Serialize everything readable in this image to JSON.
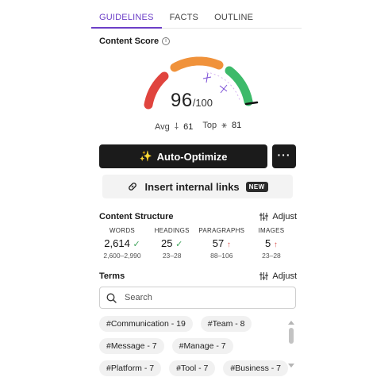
{
  "tabs": [
    {
      "label": "GUIDELINES",
      "active": true
    },
    {
      "label": "FACTS",
      "active": false
    },
    {
      "label": "OUTLINE",
      "active": false
    }
  ],
  "content_score": {
    "title": "Content Score",
    "info_icon": "info-icon",
    "score": "96",
    "max": "/100",
    "score_fraction": 0.96,
    "avg_label": "Avg",
    "avg_value": "61",
    "top_label": "Top",
    "top_value": "81",
    "colors": {
      "low": "#e0443e",
      "mid": "#f0923b",
      "high": "#3dba6a"
    }
  },
  "actions": {
    "auto_optimize_label": "Auto-Optimize",
    "auto_optimize_icon": "sparkles-icon",
    "more_label": "···",
    "internal_links_label": "Insert internal links",
    "internal_links_icon": "link-icon",
    "new_badge": "NEW"
  },
  "content_structure": {
    "title": "Content Structure",
    "adjust_label": "Adjust",
    "metrics": [
      {
        "label": "WORDS",
        "value": "2,614",
        "status": "✓",
        "range": "2,600–2,990"
      },
      {
        "label": "HEADINGS",
        "value": "25",
        "status": "✓",
        "range": "23–28"
      },
      {
        "label": "PARAGRAPHS",
        "value": "57",
        "status": "↑",
        "range": "88–106"
      },
      {
        "label": "IMAGES",
        "value": "5",
        "status": "↑",
        "range": "23–28"
      }
    ]
  },
  "terms": {
    "title": "Terms",
    "adjust_label": "Adjust",
    "search_placeholder": "Search",
    "chips": [
      [
        "#Communication - 19",
        "#Team - 8"
      ],
      [
        "#Message - 7",
        "#Manage - 7"
      ],
      [
        "#Platform - 7",
        "#Tool - 7",
        "#Business - 7"
      ]
    ]
  }
}
